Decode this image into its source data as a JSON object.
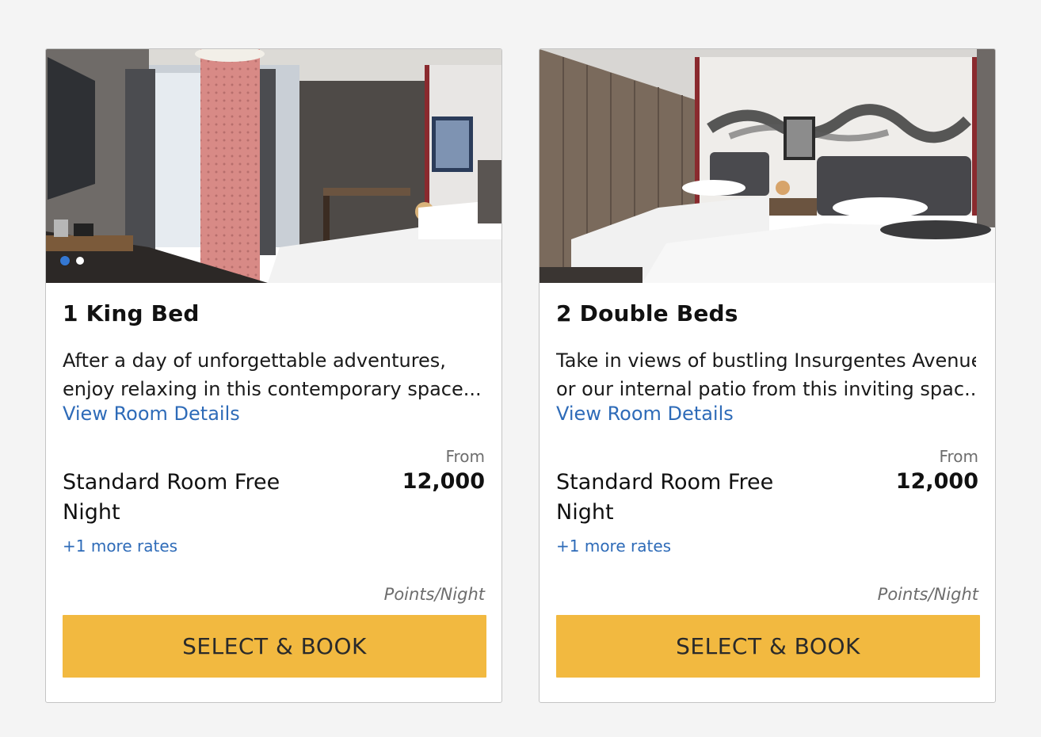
{
  "rooms": [
    {
      "title": "1 King Bed",
      "description_lines": [
        "After a day of unforgettable adventures,",
        "enjoy relaxing in this contemporary space..."
      ],
      "details_link": "View Room Details",
      "rate": {
        "from_label": "From",
        "name": "Standard Room Free Night",
        "points": "12,000",
        "more_rates": "+1 more rates",
        "unit": "Points/Night"
      },
      "cta": "SELECT & BOOK",
      "photo": {
        "icon": "room-photo-king",
        "carousel": {
          "count": 2,
          "active_index": 0
        }
      }
    },
    {
      "title": "2 Double Beds",
      "description_lines": [
        "Take in views of bustling Insurgentes Avenue",
        "or our internal patio from this inviting spac..."
      ],
      "details_link": "View Room Details",
      "rate": {
        "from_label": "From",
        "name": "Standard Room Free Night",
        "points": "12,000",
        "more_rates": "+1 more rates",
        "unit": "Points/Night"
      },
      "cta": "SELECT & BOOK",
      "photo": {
        "icon": "room-photo-doubles"
      }
    }
  ],
  "colors": {
    "page_background": "#f4f4f4",
    "card_background": "#ffffff",
    "card_border": "#c4c4c4",
    "link": "#2e6bb8",
    "button": "#f2b940",
    "button_text": "#2a2a2a",
    "muted_text": "#6d6d6d",
    "carousel_active_dot": "#3477d1"
  }
}
